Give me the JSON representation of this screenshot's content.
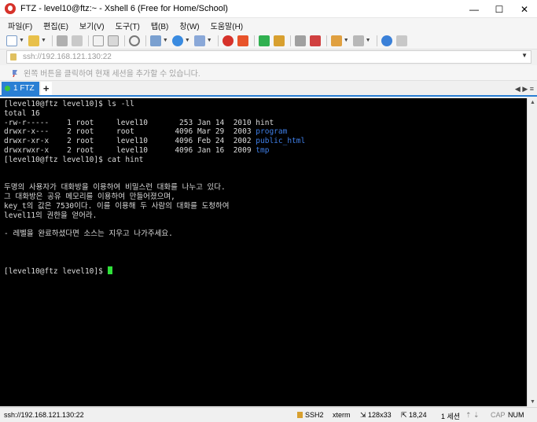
{
  "window": {
    "title": "FTZ - level10@ftz:~ - Xshell 6 (Free for Home/School)",
    "minimize": "—",
    "maximize": "☐",
    "close": "✕"
  },
  "menu": [
    "파일(F)",
    "편집(E)",
    "보기(V)",
    "도구(T)",
    "탭(B)",
    "창(W)",
    "도움말(H)"
  ],
  "address": {
    "value": "ssh://192.168.121.130:22"
  },
  "hint": {
    "text": "왼쪽 버튼을 클릭하여 현재 세션을 추가할 수 있습니다."
  },
  "tabs": [
    {
      "label": "1 FTZ",
      "status_color": "#3bc63b"
    }
  ],
  "tab_add": "+",
  "tab_nav": "◀ ▶ ≡",
  "terminal": {
    "lines": [
      "[level10@ftz level10]$ ls -ll",
      "total 16",
      "-rw-r-----    1 root     level10       253 Jan 14  2010 hint",
      "drwxr-x---    2 root     root         4096 Mar 29  2003 ",
      "drwxr-xr-x    2 root     level10      4096 Feb 24  2002 ",
      "drwxrwxr-x    2 root     level10      4096 Jan 16  2009 ",
      "[level10@ftz level10]$ cat hint",
      "",
      "",
      "두명의 사용자가 대화방을 이용하여 비밀스런 대화를 나누고 있다.",
      "그 대화방은 공유 메모리를 이용하여 만들어졌으며,",
      "key_t의 값은 7530이다. 이를 이용해 두 사람의 대화를 도청하여",
      "level11의 권한을 얻어라.",
      "",
      "- 레벨을 완료하셨다면 소스는 지우고 나가주세요.",
      "",
      "",
      "",
      "[level10@ftz level10]$ "
    ],
    "dirs": [
      "program",
      "public_html",
      "tmp"
    ],
    "dir_color": "#3f7fe8",
    "cursor_color": "#2fe03a"
  },
  "status": {
    "connection": "ssh://192.168.121.130:22",
    "protocol": "SSH2",
    "terminal_type": "xterm",
    "size": "128x33",
    "position": "18,24",
    "sessions": "1 세션",
    "caps": "CAP",
    "num": "NUM"
  }
}
